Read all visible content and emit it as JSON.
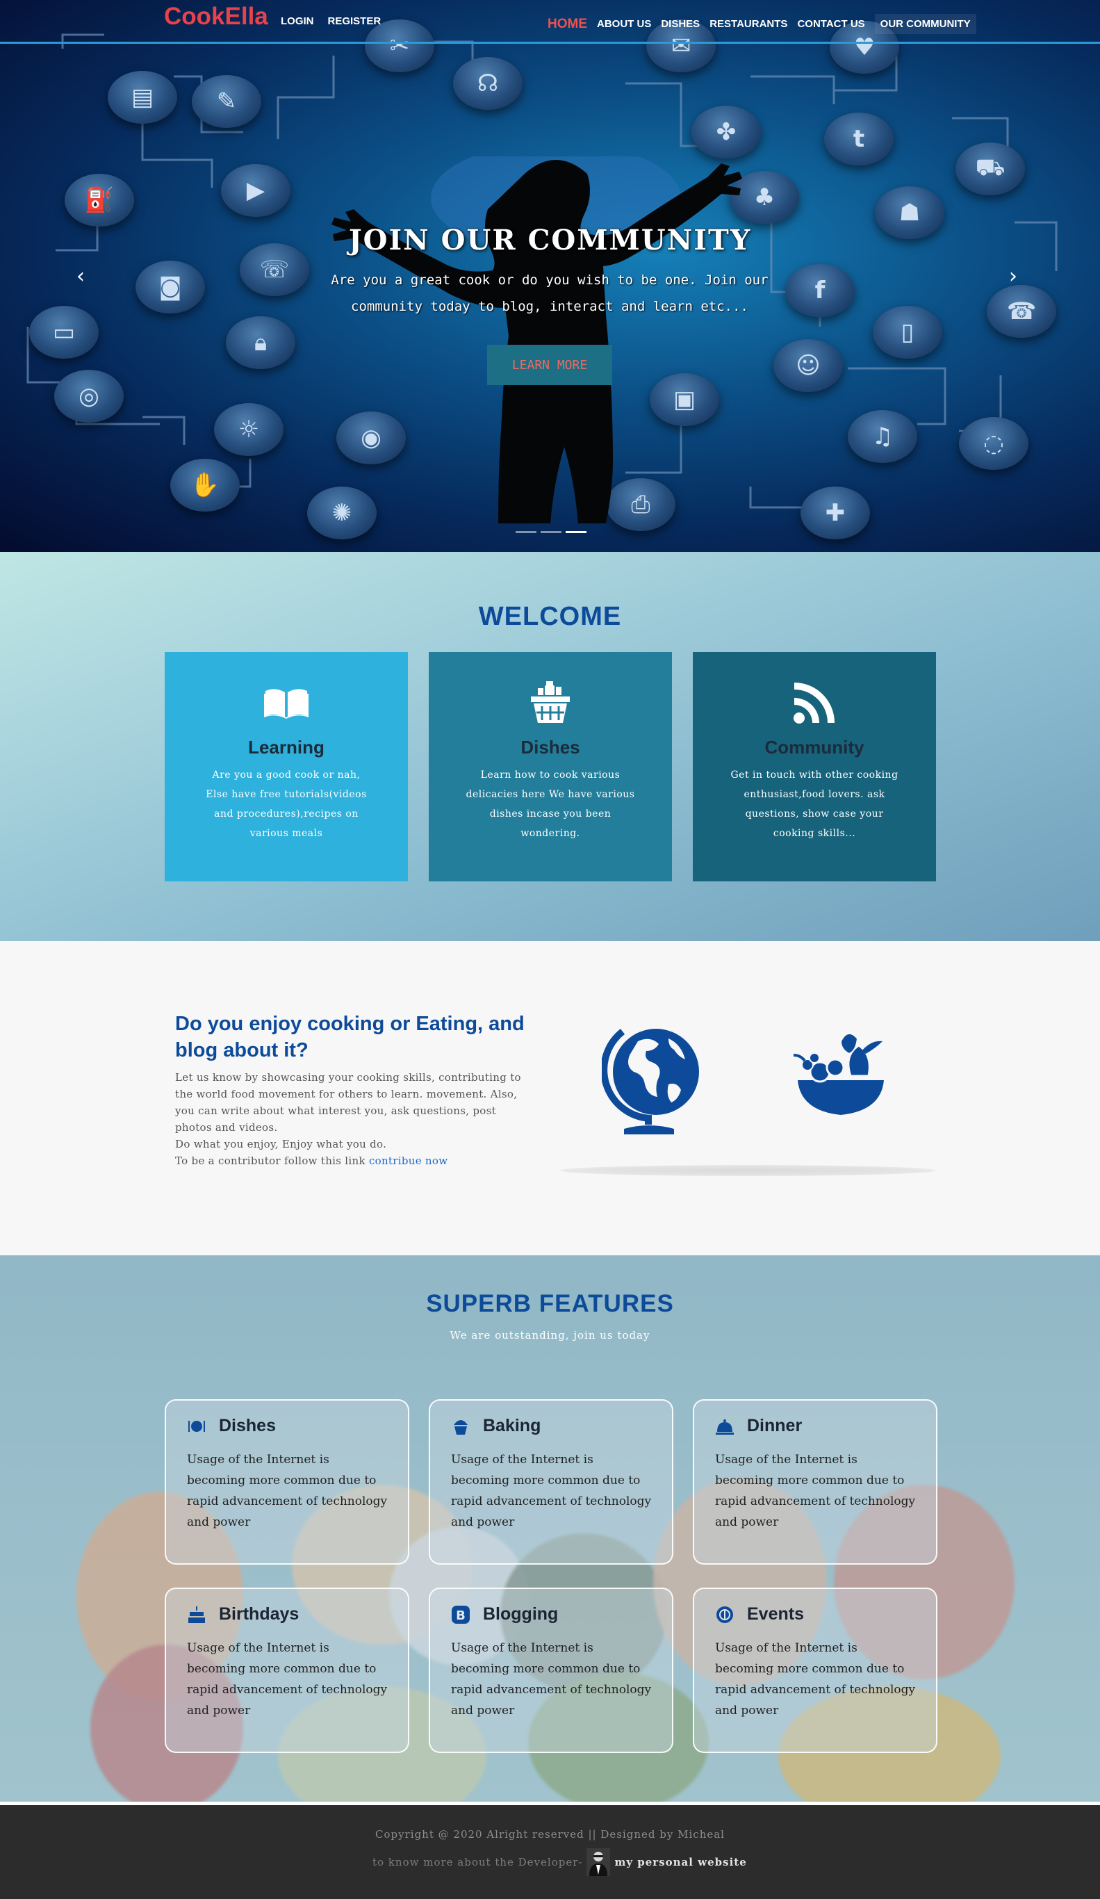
{
  "nav": {
    "logo": "CookElla",
    "login": "LOGIN",
    "register": "REGISTER",
    "links": [
      "HOME",
      "ABOUT US",
      "DISHES",
      "RESTAURANTS",
      "CONTACT US",
      "OUR COMMUNITY"
    ]
  },
  "hero": {
    "title": "JOIN OUR COMMUNITY",
    "text": "Are you a great cook or do you wish to be one. Join our community today to blog, interact and learn etc...",
    "button": "LEARN MORE",
    "prev_icon": "chevron-left-icon",
    "next_icon": "chevron-right-icon",
    "slides": 3,
    "active_slide": 3
  },
  "welcome": {
    "title": "WELCOME",
    "cards": [
      {
        "title": "Learning",
        "icon": "book-icon",
        "color": "#2eb1dc",
        "text": "Are you a good cook or nah, Else have free tutorials(videos and procedures),recipes on various meals"
      },
      {
        "title": "Dishes",
        "icon": "basket-icon",
        "color": "#237e9b",
        "text": "Learn how to cook various delicacies here We have various dishes incase you been wondering."
      },
      {
        "title": "Community",
        "icon": "rss-icon",
        "color": "#17637b",
        "text": "Get in touch with other cooking enthusiast,food lovers. ask questions, show case your cooking skills..."
      }
    ]
  },
  "blog": {
    "heading": "Do you enjoy cooking or Eating, and blog about it?",
    "text": "Let us know by showcasing your cooking skills, contributing to the world food movement for others to learn. movement. Also, you can write about what interest you, ask questions, post photos and videos.",
    "text2": "Do what you enjoy, Enjoy what you do.",
    "text3": "To be a contributor follow this link",
    "link": "contribue now"
  },
  "features": {
    "title": "SUPERB FEATURES",
    "subtitle": "We are outstanding, join us today",
    "cards": [
      {
        "title": "Dishes",
        "icon": "plate-icon",
        "text": "Usage of the Internet is becoming more common due to rapid advancement of technology and power"
      },
      {
        "title": "Baking",
        "icon": "cupcake-icon",
        "text": "Usage of the Internet is becoming more common due to rapid advancement of technology and power"
      },
      {
        "title": "Dinner",
        "icon": "cloche-icon",
        "text": "Usage of the Internet is becoming more common due to rapid advancement of technology and power"
      },
      {
        "title": "Birthdays",
        "icon": "cake-icon",
        "text": "Usage of the Internet is becoming more common due to rapid advancement of technology and power"
      },
      {
        "title": "Blogging",
        "icon": "blogger-icon",
        "text": "Usage of the Internet is becoming more common due to rapid advancement of technology and power"
      },
      {
        "title": "Events",
        "icon": "diners-icon",
        "text": "Usage of the Internet is becoming more common due to rapid advancement of technology and power"
      }
    ]
  },
  "footer": {
    "copyright": "Copyright @ 2020 Alright reserved || Designed by Micheal",
    "developer": "to know more about the Developer-",
    "link": "my personal website"
  },
  "colors": {
    "brand": "#e8424b",
    "accent": "#0d4b9a",
    "nav_line": "#2a9ad8"
  }
}
